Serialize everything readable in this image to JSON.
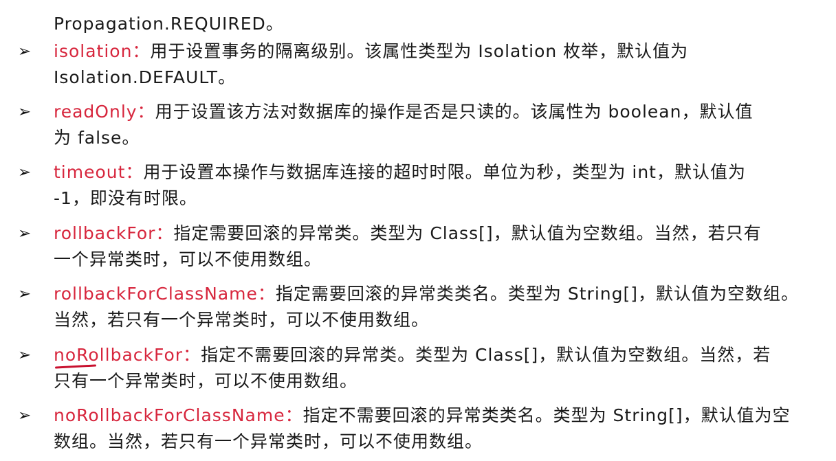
{
  "intro": {
    "text": "Propagation.REQUIRED。"
  },
  "items": [
    {
      "term": "isolation：",
      "line1": "用于设置事务的隔离级别。该属性类型为 Isolation 枚举，默认值为",
      "line2": "Isolation.DEFAULT。"
    },
    {
      "term": "readOnly：",
      "line1": "用于设置该方法对数据库的操作是否是只读的。该属性为 boolean，默认值",
      "line2": "为 false。"
    },
    {
      "term": "timeout：",
      "line1": "用于设置本操作与数据库连接的超时时限。单位为秒，类型为 int，默认值为",
      "line2": "-1，即没有时限。"
    },
    {
      "term": "rollbackFor：",
      "line1": "指定需要回滚的异常类。类型为 Class[]，默认值为空数组。当然，若只有",
      "line2": "一个异常类时，可以不使用数组。"
    },
    {
      "term": "rollbackForClassName：",
      "line1": "指定需要回滚的异常类类名。类型为 String[]，默认值为空数组。",
      "line2": "当然，若只有一个异常类时，可以不使用数组。"
    },
    {
      "term": "noRollbackFor：",
      "line1": "指定不需要回滚的异常类。类型为 Class[]，默认值为空数组。当然，若",
      "line2": "只有一个异常类时，可以不使用数组。"
    },
    {
      "term": "noRollbackForClassName：",
      "line1": "指定不需要回滚的异常类类名。类型为 String[]，默认值为空",
      "line2": "数组。当然，若只有一个异常类时，可以不使用数组。"
    }
  ],
  "colors": {
    "term": "#d7263d",
    "text": "#1a1a1a",
    "annotation": "#c8102e"
  },
  "icons": {
    "bullet": "arrow-bullet-icon"
  }
}
